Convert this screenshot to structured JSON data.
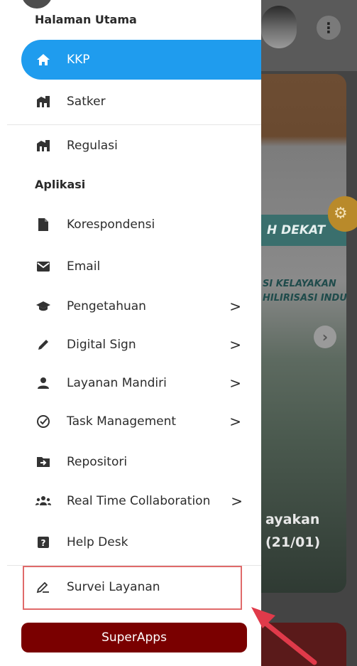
{
  "drawer": {
    "partial_top_label": "Halaman Utama",
    "items_top": [
      {
        "label": "KKP",
        "icon": "home-icon",
        "active": true
      },
      {
        "label": "Satker",
        "icon": "building-icon"
      }
    ],
    "regulasi": {
      "label": "Regulasi",
      "icon": "building-icon"
    },
    "section_aplikasi": "Aplikasi",
    "apps": [
      {
        "label": "Korespondensi",
        "icon": "document-icon",
        "chevron": false
      },
      {
        "label": "Email",
        "icon": "mail-icon",
        "chevron": false
      },
      {
        "label": "Pengetahuan",
        "icon": "graduation-cap-icon",
        "chevron": true
      },
      {
        "label": "Digital Sign",
        "icon": "pencil-icon",
        "chevron": true
      },
      {
        "label": "Layanan Mandiri",
        "icon": "person-icon",
        "chevron": true
      },
      {
        "label": "Task Management",
        "icon": "check-circle-icon",
        "chevron": true
      },
      {
        "label": "Repositori",
        "icon": "folder-arrow-icon",
        "chevron": false
      },
      {
        "label": "Real Time Collaboration",
        "icon": "group-icon",
        "chevron": true
      },
      {
        "label": "Help Desk",
        "icon": "question-icon",
        "chevron": false
      }
    ],
    "survey": {
      "label": "Survei Layanan",
      "icon": "pen-icon"
    },
    "superapps_label": "SuperApps",
    "chevron_glyph": ">"
  },
  "background": {
    "banner": "H DEKAT",
    "text_line_1": "SI KELAYAKAN",
    "text_line_2": "HILIRISASI INDU",
    "caption_line_1": "ayakan",
    "caption_line_2": "(21/01)",
    "more_glyph": "⋮"
  },
  "colors": {
    "accent": "#1f9cee",
    "superapps": "#7a0000",
    "highlight": "#e06a6a"
  }
}
